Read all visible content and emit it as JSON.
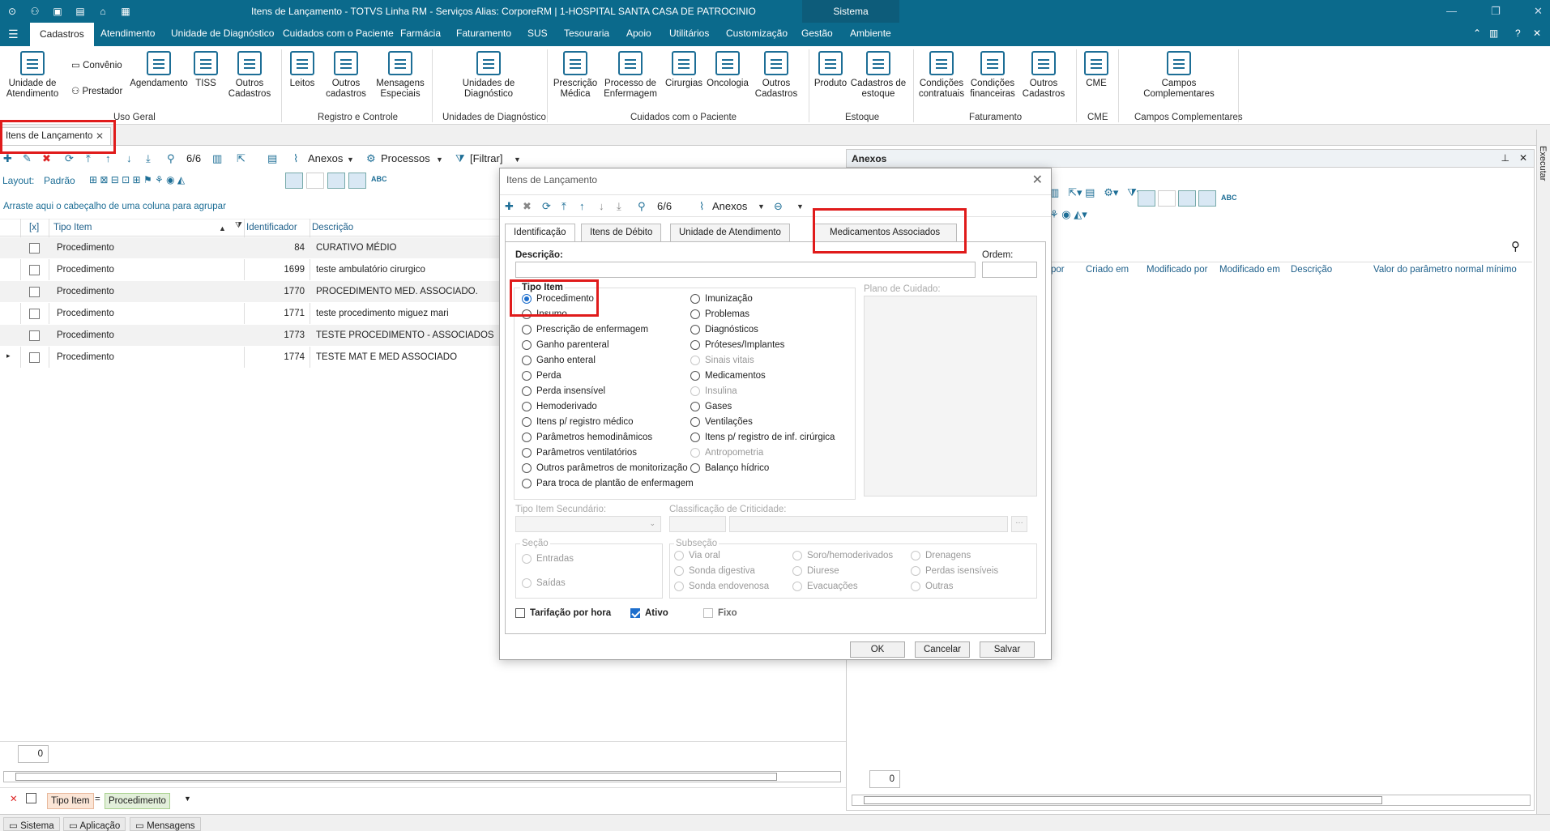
{
  "window": {
    "title": "Itens de Lançamento - TOTVS Linha RM - Serviços  Alias: CorporeRM | 1-HOSPITAL SANTA CASA DE PATROCINIO",
    "system_label": "Sistema"
  },
  "menu": {
    "tabs": [
      "Cadastros",
      "Atendimento",
      "Unidade de Diagnóstico",
      "Cuidados com o Paciente",
      "Farmácia",
      "Faturamento",
      "SUS",
      "Tesouraria",
      "Apoio",
      "Utilitários",
      "Customização",
      "Gestão",
      "Ambiente"
    ]
  },
  "ribbon": {
    "buttons": [
      "Unidade de Atendimento",
      "Agendamento",
      "TISS",
      "Outros Cadastros",
      "Leitos",
      "Outros cadastros",
      "Mensagens Especiais",
      "Unidades de Diagnóstico",
      "Prescrição Médica",
      "Processo de Enfermagem",
      "Cirurgias",
      "Oncologia",
      "Outros Cadastros",
      "Produto",
      "Cadastros de estoque",
      "Condições contratuais",
      "Condições financeiras",
      "Outros Cadastros",
      "CME",
      "Campos Complementares"
    ],
    "small": [
      "Convênio",
      "Prestador"
    ],
    "groups": [
      "Uso Geral",
      "Registro e Controle",
      "Unidades de Diagnóstico",
      "Cuidados com o Paciente",
      "Estoque",
      "Faturamento",
      "CME",
      "Campos Complementares"
    ]
  },
  "doc_tab": {
    "label": "Itens de Lançamento"
  },
  "toolbar": {
    "count": "6/6",
    "anexos": "Anexos",
    "processos": "Processos",
    "filtrar": "[Filtrar]",
    "layout_label": "Layout:",
    "layout_value": "Padrão"
  },
  "grid": {
    "group_hint": "Arraste aqui o cabeçalho de uma coluna para agrupar",
    "headers": [
      "[x]",
      "Tipo Item",
      "Identificador",
      "Descrição"
    ],
    "rows": [
      {
        "tipo": "Procedimento",
        "id": "84",
        "desc": "CURATIVO MÉDIO"
      },
      {
        "tipo": "Procedimento",
        "id": "1699",
        "desc": "teste ambulatório cirurgico"
      },
      {
        "tipo": "Procedimento",
        "id": "1770",
        "desc": "PROCEDIMENTO MED. ASSOCIADO."
      },
      {
        "tipo": "Procedimento",
        "id": "1771",
        "desc": "teste procedimento miguez mari"
      },
      {
        "tipo": "Procedimento",
        "id": "1773",
        "desc": "TESTE PROCEDIMENTO - ASSOCIADOS"
      },
      {
        "tipo": "Procedimento",
        "id": "1774",
        "desc": "TESTE MAT E MED ASSOCIADO"
      }
    ],
    "footer_count": "0"
  },
  "filterbar": {
    "field": "Tipo Item",
    "op": "=",
    "value": "Procedimento"
  },
  "statusbar": [
    "Sistema",
    "Aplicação",
    "Mensagens"
  ],
  "anexos_panel": {
    "title": "Anexos",
    "headers": [
      "por",
      "Criado em",
      "Modificado por",
      "Modificado em",
      "Descrição",
      "Valor do parâmetro normal mínimo"
    ],
    "footer_count": "0",
    "side_label": "Executar"
  },
  "dialog": {
    "title": "Itens de Lançamento",
    "count": "6/6",
    "anexos": "Anexos",
    "tabs": [
      "Identificação",
      "Itens de Débito",
      "Unidade de Atendimento",
      "Medicamentos Associados"
    ],
    "descricao_label": "Descrição:",
    "ordem_label": "Ordem:",
    "tipo_item_label": "Tipo Item",
    "plano_label": "Plano de Cuidado:",
    "tipo_col1": [
      "Procedimento",
      "Insumo",
      "Prescrição de enfermagem",
      "Ganho parenteral",
      "Ganho enteral",
      "Perda",
      "Perda insensível",
      "Hemoderivado",
      "Itens p/ registro médico",
      "Parâmetros hemodinâmicos",
      "Parâmetros ventilatórios",
      "Outros parâmetros de monitorização",
      "Para troca de plantão de enfermagem"
    ],
    "tipo_col2": [
      "Imunização",
      "Problemas",
      "Diagnósticos",
      "Próteses/Implantes",
      "Sinais vitais",
      "Medicamentos",
      "Insulina",
      "Gases",
      "Ventilações",
      "Itens p/ registro de inf. cirúrgica",
      "Antropometria",
      "Balanço hídrico"
    ],
    "tipo_sec_label": "Tipo Item Secundário:",
    "classif_label": "Classificação de Criticidade:",
    "secao_label": "Seção",
    "secao": [
      "Entradas",
      "Saídas"
    ],
    "subsecao_label": "Subseção",
    "subsecao": [
      "Via oral",
      "Sonda digestiva",
      "Sonda endovenosa",
      "Soro/hemoderivados",
      "Diurese",
      "Evacuações",
      "Drenagens",
      "Perdas isensíveis",
      "Outras"
    ],
    "chk_tarif": "Tarifação por hora",
    "chk_ativo": "Ativo",
    "chk_fixo": "Fixo",
    "btn_ok": "OK",
    "btn_cancel": "Cancelar",
    "btn_save": "Salvar"
  }
}
